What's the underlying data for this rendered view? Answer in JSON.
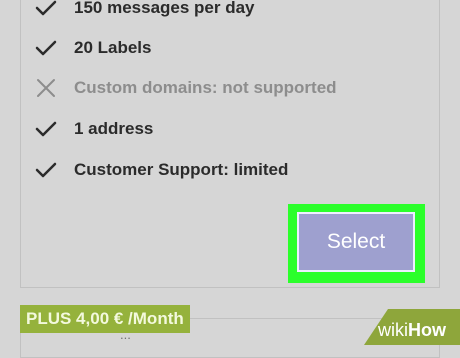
{
  "features": [
    {
      "label": "150 messages per day",
      "status": "included",
      "icon": "checkmark-icon"
    },
    {
      "label": "20 Labels",
      "status": "included",
      "icon": "checkmark-icon"
    },
    {
      "label": "Custom domains: not supported",
      "status": "excluded",
      "icon": "x-mark-icon"
    },
    {
      "label": "1 address",
      "status": "included",
      "icon": "checkmark-icon"
    },
    {
      "label": "Customer Support: limited",
      "status": "included",
      "icon": "checkmark-icon"
    }
  ],
  "select_button": {
    "label": "Select",
    "highlight_color": "#2bff2b"
  },
  "plus_plan": {
    "title": "PLUS 4,00 € /Month",
    "description": "...",
    "badge_color": "#95b23c"
  },
  "watermark": {
    "part1": "wiki",
    "part2": "How"
  }
}
